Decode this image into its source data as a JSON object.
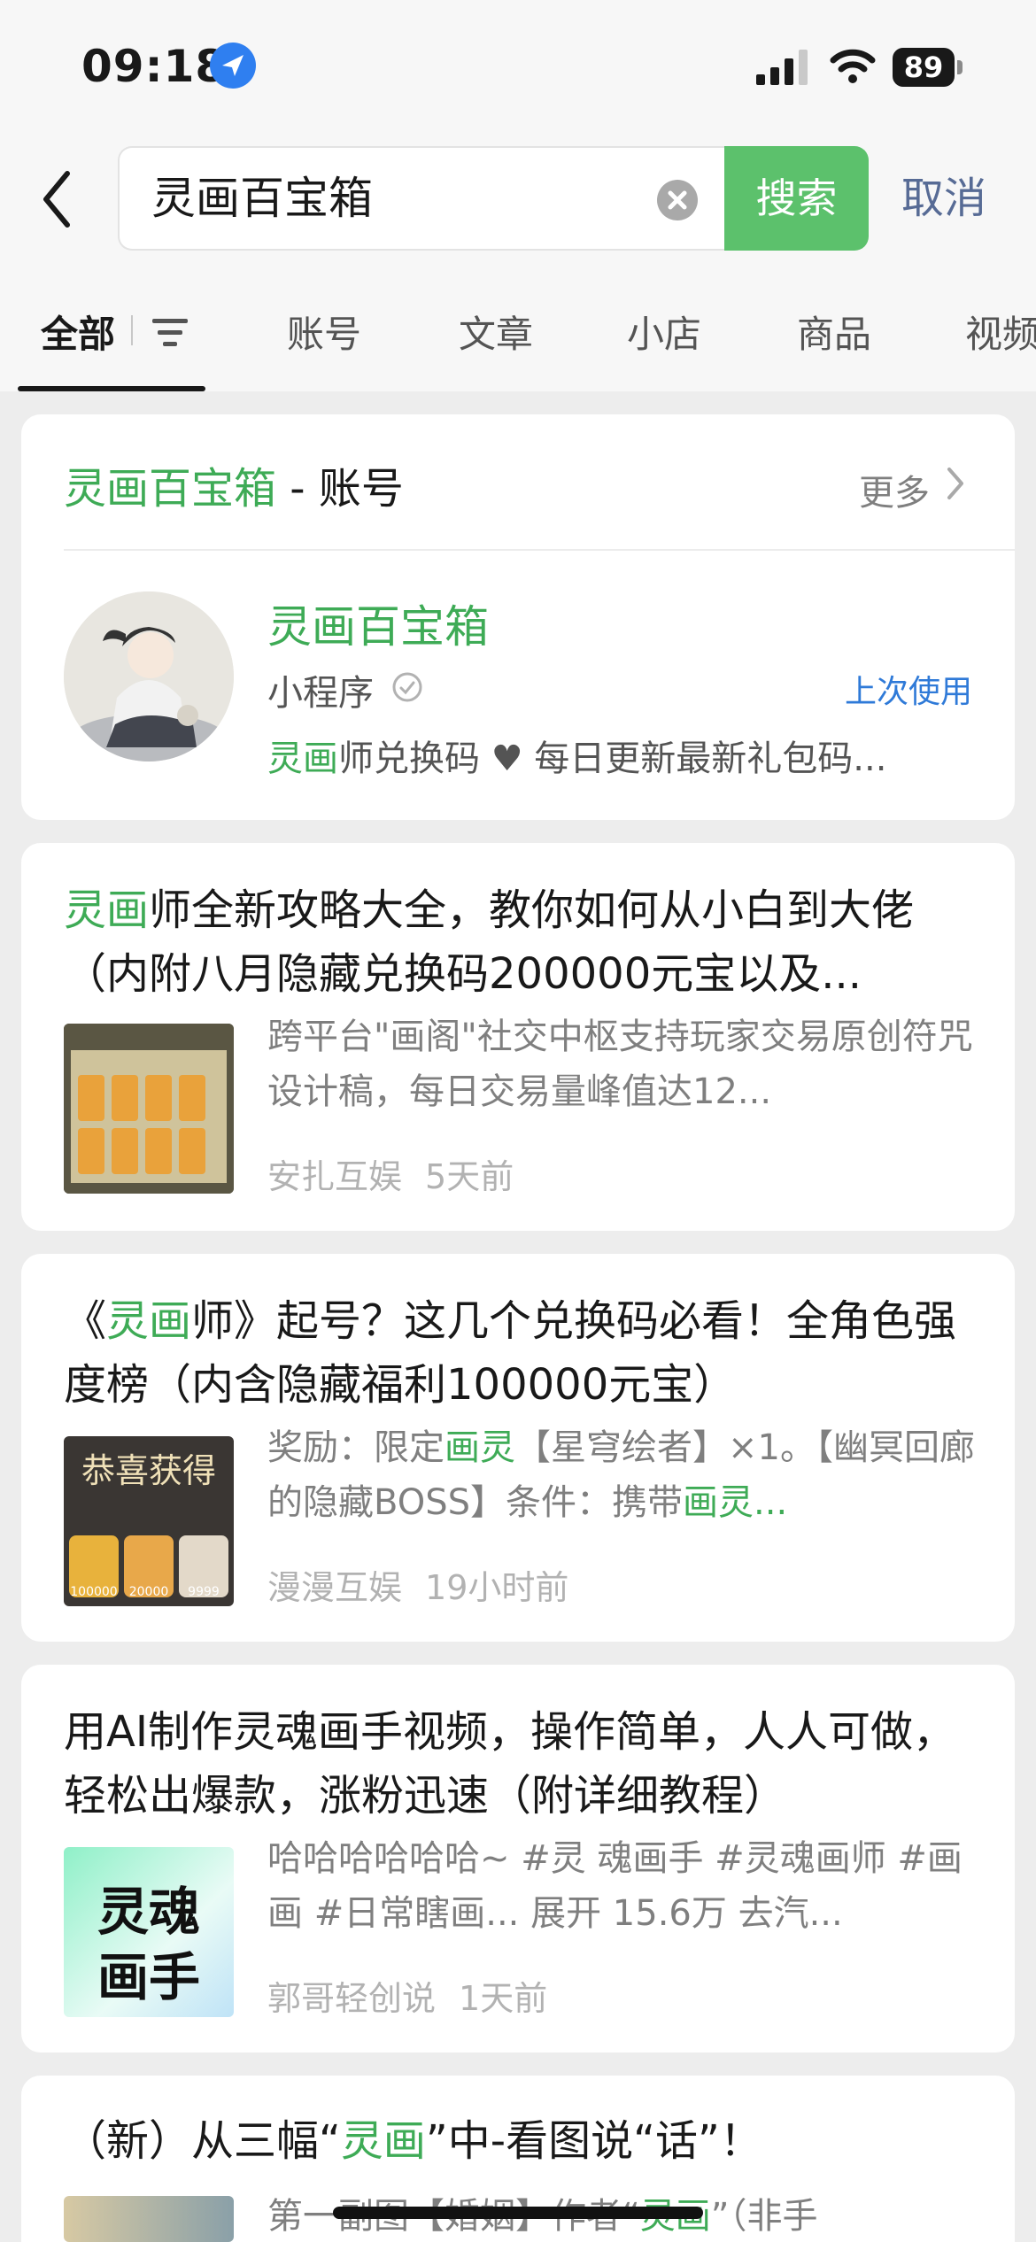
{
  "status_bar": {
    "time": "09:18",
    "battery": "89"
  },
  "search": {
    "query": "灵画百宝箱",
    "search_label": "搜索",
    "cancel_label": "取消"
  },
  "tabs": [
    "全部",
    "账号",
    "文章",
    "小店",
    "商品",
    "视频"
  ],
  "account_card": {
    "header_highlight": "灵画百宝箱",
    "header_suffix": " - 账号",
    "more_label": "更多",
    "name": "灵画百宝箱",
    "type": "小程序",
    "last_used": "上次使用",
    "desc_highlight": "灵画",
    "desc_rest": "师兑换码 ♥ 每日更新最新礼包码..."
  },
  "articles": [
    {
      "title_hl": "灵画",
      "title_rest": "师全新攻略大全，教你如何从小白到大佬（内附八月隐藏兑换码200000元宝以及...",
      "desc": "跨平台\"画阁\"社交中枢支持玩家交易原创符咒设计稿，每日交易量峰值达12...",
      "source": "安扎互娱",
      "time": "5天前"
    },
    {
      "title_pre": "《",
      "title_hl": "灵画",
      "title_rest": "师》起号？这几个兑换码必看！全角色强度榜（内含隐藏福利100000元宝）",
      "desc_pre": "奖励：限定",
      "desc_hl1": "画灵",
      "desc_mid": "【星穹绘者】×1。【幽冥回廊的隐藏BOSS】条件：携带",
      "desc_hl2": "画灵...",
      "thumb_text": "恭喜获得",
      "thumb_nums": [
        "100000",
        "20000",
        "9999"
      ],
      "source": "漫漫互娱",
      "time": "19小时前"
    },
    {
      "title": "用AI制作灵魂画手视频，操作简单，人人可做，轻松出爆款，涨粉迅速（附详细教程）",
      "desc": "哈哈哈哈哈哈~ #灵 魂画手 #灵魂画师 #画画 #日常瞎画... 展开 15.6万 去汽...",
      "thumb_line1": "灵魂",
      "thumb_line2": "画手",
      "source": "郭哥轻创说",
      "time": "1天前"
    },
    {
      "title_pre": "（新）从三幅“",
      "title_hl": "灵画",
      "title_rest": "”中-看图说“话”！",
      "desc_pre": "第一副图【婚姻】作者“",
      "desc_hl": "灵画",
      "desc_rest": "”（非手"
    }
  ]
}
